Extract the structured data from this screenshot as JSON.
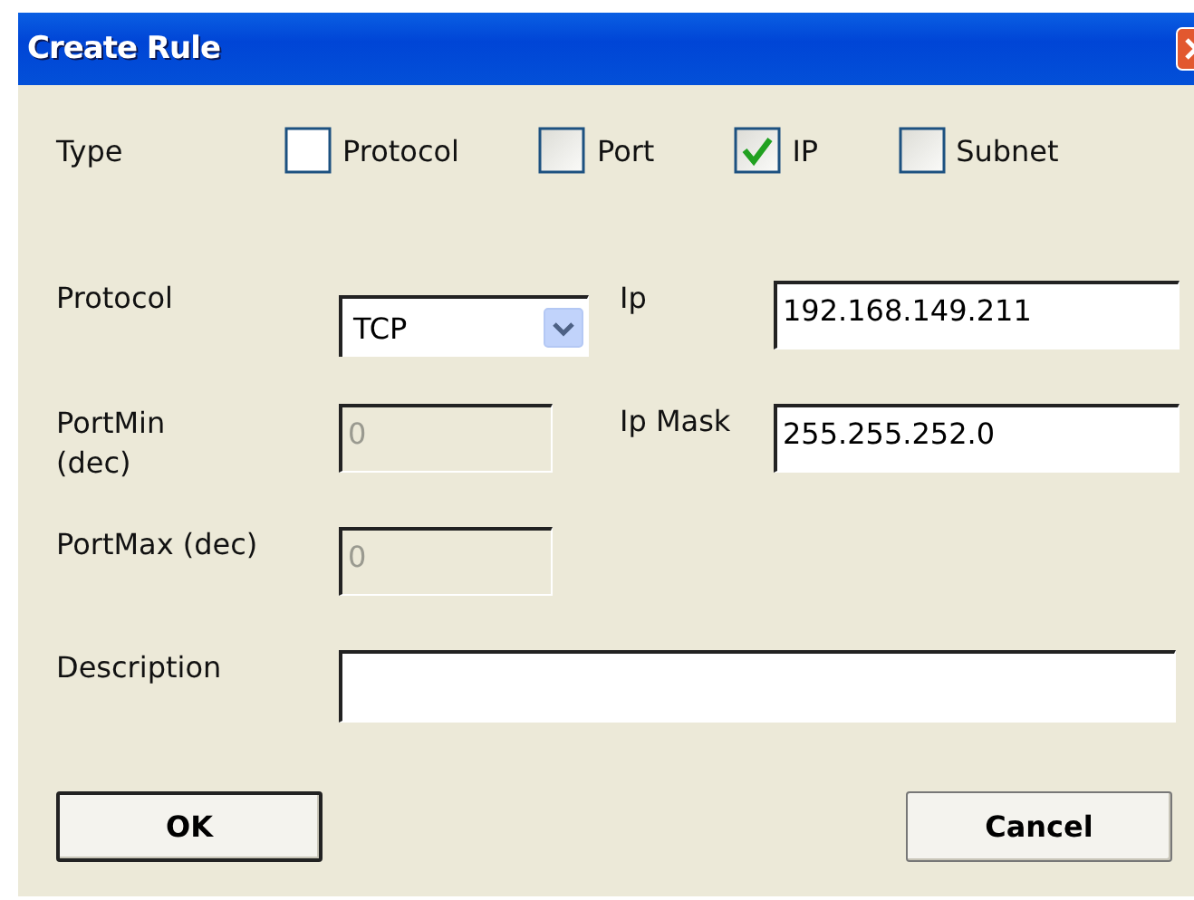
{
  "window": {
    "title": "Create Rule"
  },
  "type": {
    "label": "Type",
    "options": [
      {
        "label": "Protocol",
        "checked": false,
        "disabled": false
      },
      {
        "label": "Port",
        "checked": false,
        "disabled": true
      },
      {
        "label": "IP",
        "checked": true,
        "disabled": true
      },
      {
        "label": "Subnet",
        "checked": false,
        "disabled": true
      }
    ]
  },
  "protocol": {
    "label": "Protocol",
    "value": "TCP"
  },
  "ip": {
    "label": "Ip",
    "value": "192.168.149.211"
  },
  "port_min": {
    "label": "PortMin (dec)",
    "value": "0",
    "disabled": true
  },
  "ip_mask": {
    "label": "Ip Mask",
    "value": "255.255.252.0"
  },
  "port_max": {
    "label": "PortMax (dec)",
    "value": "0",
    "disabled": true
  },
  "description": {
    "label": "Description"
  },
  "buttons": [
    {
      "label": "OK",
      "default": true
    },
    {
      "label": "Cancel",
      "default": false
    }
  ]
}
